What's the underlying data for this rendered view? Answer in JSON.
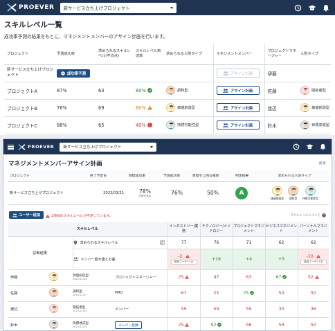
{
  "brand": {
    "name": "PROEVER"
  },
  "colors": {
    "navbar": "#1f3452",
    "primary": "#1f4d82",
    "green": "#2e7d32",
    "orange": "#e07b00",
    "red": "#d32f2f"
  },
  "skill_list": {
    "project_select": "新サービス立ち上げプロジェクト",
    "title": "スキルレベル一覧",
    "lead": "成功率予測の結果をもとに、マネジメントメンバーのアサイン計画を行います。",
    "columns": [
      "プロジェクト",
      "予測成功率",
      "求められるスキルレベル(平均点)",
      "スキルレベル到達率",
      "求められる人財タイプ",
      "マネジメントメンバー",
      "プロジェクトマネージャー",
      "人財タイプ"
    ],
    "rows": [
      {
        "project": "新サービス立ち上げプロジェクト",
        "rate": "",
        "action": "成功率予測",
        "skill": "",
        "reach": "",
        "reach_status": "",
        "type": "",
        "assign": "アサイン計画",
        "assign_enabled": false,
        "pm": "伊藤",
        "pm_type": ""
      },
      {
        "project": "プロジェクトA",
        "rate": "87%",
        "action": "",
        "skill": "63",
        "reach": "80%",
        "reach_status": "good",
        "type": "調和型",
        "assign": "アサイン計画",
        "assign_enabled": true,
        "pm": "佐藤",
        "pm_type": "開拓者型"
      },
      {
        "project": "プロジェクトB",
        "rate": "76%",
        "action": "",
        "skill": "69",
        "reach": "60%",
        "reach_status": "warn",
        "type": "価値創造型",
        "assign": "アサイン計画",
        "assign_enabled": true,
        "pm": "渡辺",
        "pm_type": "価値創造型"
      },
      {
        "project": "プロジェクトC",
        "rate": "88%",
        "action": "",
        "skill": "65",
        "reach": "40%",
        "reach_status": "alert",
        "type": "持続可能性型",
        "assign": "アサイン計画",
        "assign_enabled": true,
        "pm": "鈴木",
        "pm_type": "目標達成型"
      }
    ]
  },
  "assign_plan": {
    "project_select": "新サービス立ち上げプロジェクト",
    "title": "マネジメントメンバーアサイン計画",
    "back": "戻る",
    "summary_columns": [
      "プロジェクト",
      "終了予定日",
      "目標成功率",
      "予測成功率",
      "目標を上回る確率",
      "判定結果",
      "求められる人財タイプ"
    ],
    "summary": {
      "project": "新サービス立ち上げプロジェクト",
      "end_date": "2023/03/31",
      "target_rate": "78%",
      "target_note": "内訳を見る",
      "predicted_rate": "76%",
      "exceed_prob": "50%",
      "result": "A",
      "types": [
        "価値創造型",
        "調和型",
        "持続可能性型"
      ]
    },
    "add_user": "ユーザー追加",
    "warning": "2項目のスキルレベルが不足しています。",
    "about_skill": "スキルレベルについて",
    "skill_level_label": "スキルレベル",
    "diag_label": "診断結果",
    "required_label": "求められるスキルレベル",
    "diff_label": "メンバー最大値との差",
    "skill_columns": [
      "インダストリー/業務",
      "テクノロジー/メソドロジー",
      "プロジェクトマネジメント",
      "ビジネスマネジメント",
      "パーソナルマネジメント"
    ],
    "required": [
      "77",
      "76",
      "71",
      "62",
      "62"
    ],
    "diff": [
      "-2",
      "+16",
      "+4",
      "+5",
      "-10"
    ],
    "diff_note": "推奨ユーザー1名",
    "members": [
      {
        "name": "伊藤",
        "type": "価値創造型",
        "date": "2022/11/18",
        "role": "プロジェクトマネージャー",
        "role_button": false,
        "scores": [
          "75",
          "47",
          "63",
          "67",
          "52"
        ]
      },
      {
        "name": "佐藤",
        "type": "調和型",
        "date": "2021/11/07",
        "role": "PMO",
        "role_button": false,
        "scores": [
          "67",
          "25",
          "75",
          "50",
          "50"
        ]
      },
      {
        "name": "渡辺",
        "type": "開拓者型",
        "date": "2021/11/01",
        "role": "メンバー",
        "role_button": false,
        "scores": [
          "59",
          "59",
          "59",
          "30",
          "36"
        ]
      },
      {
        "name": "鈴木",
        "type": "目標達成型",
        "date": "2021/11/25",
        "role": "メンバー登録",
        "role_button": true,
        "scores": [
          "75",
          "92",
          "56",
          "59",
          "50"
        ]
      }
    ]
  }
}
